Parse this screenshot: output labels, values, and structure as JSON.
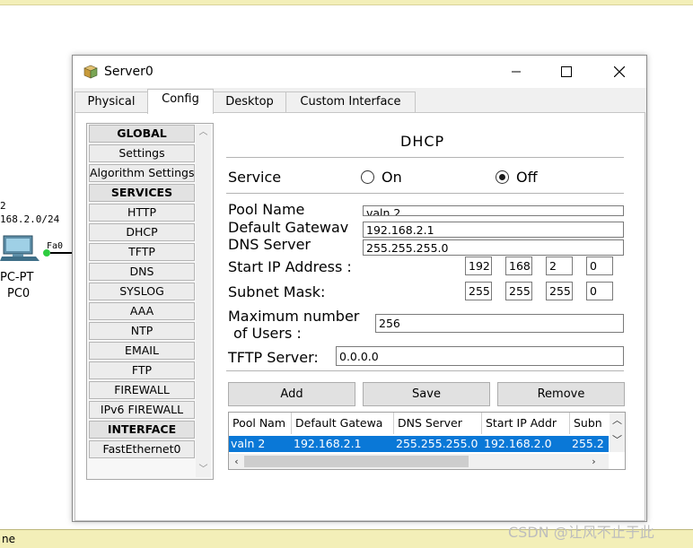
{
  "window": {
    "title": "Server0",
    "controls": {
      "minimize_icon": "minimize-icon",
      "maximize_icon": "maximize-icon",
      "close_icon": "close-icon"
    }
  },
  "tabs": [
    {
      "label": "Physical",
      "active": false
    },
    {
      "label": "Config",
      "active": true
    },
    {
      "label": "Desktop",
      "active": false
    },
    {
      "label": "Custom Interface",
      "active": false
    }
  ],
  "sidebar": {
    "items": [
      {
        "label": "GLOBAL",
        "header": true
      },
      {
        "label": "Settings",
        "header": false
      },
      {
        "label": "Algorithm Settings",
        "header": false
      },
      {
        "label": "SERVICES",
        "header": true
      },
      {
        "label": "HTTP",
        "header": false
      },
      {
        "label": "DHCP",
        "header": false
      },
      {
        "label": "TFTP",
        "header": false
      },
      {
        "label": "DNS",
        "header": false
      },
      {
        "label": "SYSLOG",
        "header": false
      },
      {
        "label": "AAA",
        "header": false
      },
      {
        "label": "NTP",
        "header": false
      },
      {
        "label": "EMAIL",
        "header": false
      },
      {
        "label": "FTP",
        "header": false
      },
      {
        "label": "FIREWALL",
        "header": false
      },
      {
        "label": "IPv6 FIREWALL",
        "header": false
      },
      {
        "label": "INTERFACE",
        "header": true
      },
      {
        "label": "FastEthernet0",
        "header": false
      }
    ]
  },
  "dhcp": {
    "title": "DHCP",
    "service_label": "Service",
    "on_label": "On",
    "off_label": "Off",
    "service_state": "Off",
    "pool_name_label": "Pool Name",
    "pool_name_value": "valn 2",
    "default_gateway_label": "Default Gatewav",
    "default_gateway_value": "192.168.2.1",
    "dns_server_label": "DNS Server",
    "dns_server_value": "255.255.255.0",
    "start_ip_label": "Start IP Address :",
    "start_ip": [
      "192",
      "168",
      "2",
      "0"
    ],
    "subnet_mask_label": "Subnet Mask:",
    "subnet_mask": [
      "255",
      "255",
      "255",
      "0"
    ],
    "max_users_label_1": "Maximum number",
    "max_users_label_2": "of Users :",
    "max_users_value": "256",
    "tftp_label": "TFTP Server:",
    "tftp_value": "0.0.0.0",
    "add_label": "Add",
    "save_label": "Save",
    "remove_label": "Remove"
  },
  "pool_table": {
    "columns": [
      "Pool Nam",
      "Default Gatewa",
      "DNS Server",
      "Start IP Addr",
      "Subn"
    ],
    "rows": [
      [
        "valn 2",
        "192.168.2.1",
        "255.255.255.0",
        "192.168.2.0",
        "255.2"
      ]
    ]
  },
  "topology": {
    "network_line_1": "2",
    "network_line_2": "168.2.0/24",
    "port_label": "Fa0",
    "device_type": "PC-PT",
    "device_name": "PC0"
  },
  "status_bar": {
    "text": "ne"
  },
  "watermark": "CSDN @让风不止于此"
}
